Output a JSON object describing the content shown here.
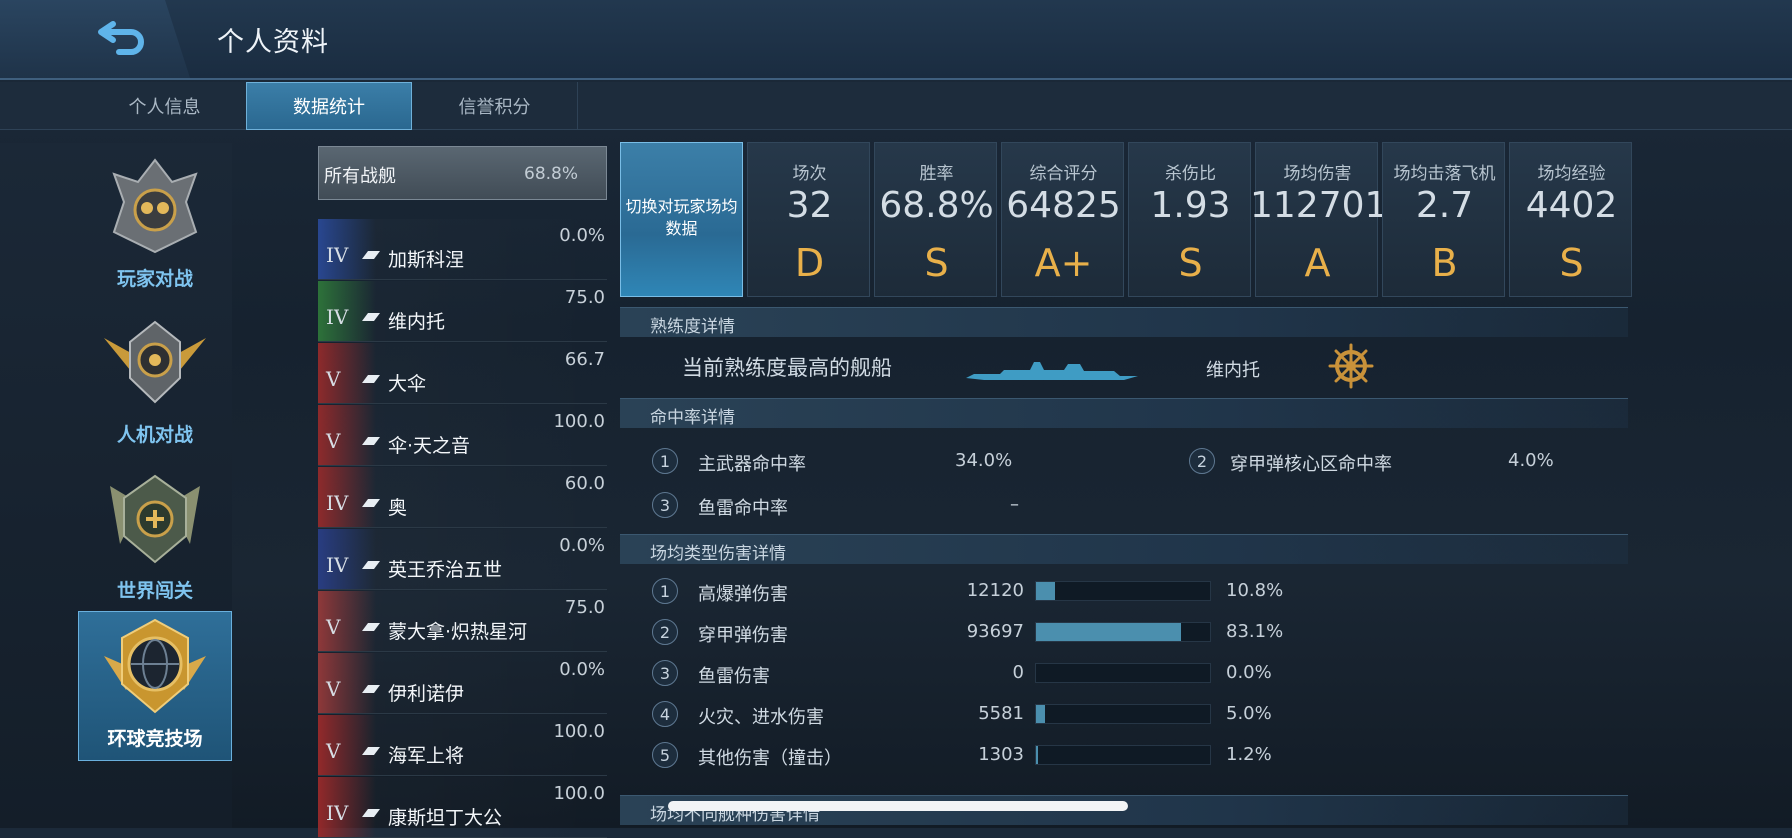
{
  "header": {
    "title": "个人资料",
    "back_icon": "back-arrow-icon"
  },
  "tabs": [
    "个人信息",
    "数据统计",
    "信誉积分"
  ],
  "modes": [
    "玩家对战",
    "人机对战",
    "世界闯关",
    "环球竞技场"
  ],
  "ship_list": {
    "all": {
      "label": "所有战舰",
      "value": "68.8%"
    },
    "ships": [
      {
        "tier": "IV",
        "name": "加斯科涅",
        "value": "0.0%",
        "flag": "#2a4a9a"
      },
      {
        "tier": "IV",
        "name": "维内托",
        "value": "75.0",
        "flag": "#2f7a3a"
      },
      {
        "tier": "V",
        "name": "大伞",
        "value": "66.7",
        "flag": "#9a2a2a"
      },
      {
        "tier": "V",
        "name": "伞·天之音",
        "value": "100.0",
        "flag": "#9a2a2a"
      },
      {
        "tier": "IV",
        "name": "奥",
        "value": "60.0",
        "flag": "#9a2a2a"
      },
      {
        "tier": "IV",
        "name": "英王乔治五世",
        "value": "0.0%",
        "flag": "#2a3f8a"
      },
      {
        "tier": "V",
        "name": "蒙大拿·炽热星河",
        "value": "75.0",
        "flag": "#9b3a3a"
      },
      {
        "tier": "V",
        "name": "伊利诺伊",
        "value": "0.0%",
        "flag": "#9b3a3a"
      },
      {
        "tier": "V",
        "name": "海军上将",
        "value": "100.0",
        "flag": "#a02a2a"
      },
      {
        "tier": "IV",
        "name": "康斯坦丁大公",
        "value": "100.0",
        "flag": "#a02a2a"
      }
    ]
  },
  "switch_button": "切换对玩家场均数据",
  "stats": [
    {
      "title": "场次",
      "value": "32",
      "grade": "D"
    },
    {
      "title": "胜率",
      "value": "68.8%",
      "grade": "S"
    },
    {
      "title": "综合评分",
      "value": "64825",
      "grade": "A+"
    },
    {
      "title": "杀伤比",
      "value": "1.93",
      "grade": "S"
    },
    {
      "title": "场均伤害",
      "value": "112701",
      "grade": "A"
    },
    {
      "title": "场均击落飞机",
      "value": "2.7",
      "grade": "B"
    },
    {
      "title": "场均经验",
      "value": "4402",
      "grade": "S"
    }
  ],
  "proficiency": {
    "section_title": "熟练度详情",
    "label": "当前熟练度最高的舰船",
    "ship": "维内托",
    "icon": "ship-wheel-icon"
  },
  "accuracy": {
    "section_title": "命中率详情",
    "items": [
      {
        "num": "1",
        "label": "主武器命中率",
        "value": "34.0%"
      },
      {
        "num": "2",
        "label": "穿甲弹核心区命中率",
        "value": "4.0%"
      },
      {
        "num": "3",
        "label": "鱼雷命中率",
        "value": "–"
      }
    ]
  },
  "damage": {
    "section_title": "场均类型伤害详情",
    "items": [
      {
        "num": "1",
        "label": "高爆弹伤害",
        "value": "12120",
        "percent": "10.8%",
        "fraction": 0.108
      },
      {
        "num": "2",
        "label": "穿甲弹伤害",
        "value": "93697",
        "percent": "83.1%",
        "fraction": 0.831
      },
      {
        "num": "3",
        "label": "鱼雷伤害",
        "value": "0",
        "percent": "0.0%",
        "fraction": 0.0
      },
      {
        "num": "4",
        "label": "火灾、进水伤害",
        "value": "5581",
        "percent": "5.0%",
        "fraction": 0.05
      },
      {
        "num": "5",
        "label": "其他伤害（撞击）",
        "value": "1303",
        "percent": "1.2%",
        "fraction": 0.012
      }
    ]
  },
  "next_section_title": "场均不同舰种伤害详情"
}
